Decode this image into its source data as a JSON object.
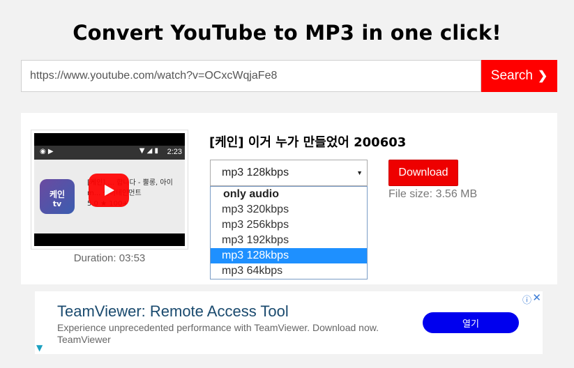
{
  "header": {
    "title": "Convert YouTube to MP3 in one click!"
  },
  "search": {
    "value": "https://www.youtube.com/watch?v=OCxcWqjaFe8",
    "button_label": "Search",
    "button_icon": "chevron-right-icon"
  },
  "video": {
    "title": "[케인] 이거 누가 만들었어 200603",
    "duration": "Duration: 03:53",
    "thumbnail": {
      "status_time": "2:23",
      "app_icon_text": "케인",
      "app_icon_sub": "tv",
      "line1": "[케인] ... 합니다 - 뿔롱, 아이",
      "line2": "m...  센터테인먼트",
      "line3": "5.0 ★   100+"
    }
  },
  "format_select": {
    "selected": "mp3 128kbps",
    "group_label": "only audio",
    "options": [
      "mp3 320kbps",
      "mp3 256kbps",
      "mp3 192kbps",
      "mp3 128kbps",
      "mp3 64kbps"
    ],
    "selected_index": 3
  },
  "download": {
    "button_label": "Download",
    "file_size": "File size: 3.56 MB"
  },
  "ad": {
    "title": "TeamViewer: Remote Access Tool",
    "description": "Experience unprecedented performance with TeamViewer. Download now.",
    "advertiser": "TeamViewer",
    "cta_label": "열기",
    "info_icon": "info-icon",
    "close_icon": "close-icon"
  },
  "colors": {
    "accent_red": "#ff0000",
    "selected_option": "#1e90ff",
    "ad_button": "#0000ee"
  }
}
